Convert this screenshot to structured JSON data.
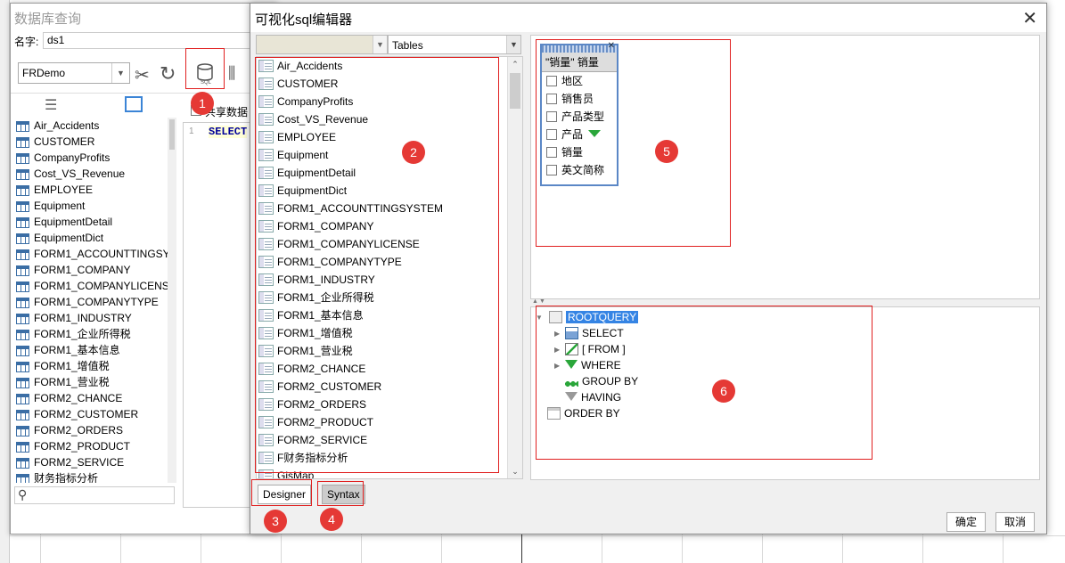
{
  "back_window": {
    "title": "数据库查询",
    "name_label": "名字:",
    "name_value": "ds1",
    "connection": "FRDemo",
    "share_label": "共享数据",
    "line_no": "1",
    "sql_text": "SELECT",
    "tables": [
      "Air_Accidents",
      "CUSTOMER",
      "CompanyProfits",
      "Cost_VS_Revenue",
      "EMPLOYEE",
      "Equipment",
      "EquipmentDetail",
      "EquipmentDict",
      "FORM1_ACCOUNTTINGSY",
      "FORM1_COMPANY",
      "FORM1_COMPANYLICENS",
      "FORM1_COMPANYTYPE",
      "FORM1_INDUSTRY",
      "FORM1_企业所得税",
      "FORM1_基本信息",
      "FORM1_增值税",
      "FORM1_营业税",
      "FORM2_CHANCE",
      "FORM2_CUSTOMER",
      "FORM2_ORDERS",
      "FORM2_PRODUCT",
      "FORM2_SERVICE",
      "财务指标分析"
    ]
  },
  "dialog": {
    "title": "可视化sql编辑器",
    "close_glyph": "✕",
    "type_select": "Tables",
    "tables": [
      "Air_Accidents",
      "CUSTOMER",
      "CompanyProfits",
      "Cost_VS_Revenue",
      "EMPLOYEE",
      "Equipment",
      "EquipmentDetail",
      "EquipmentDict",
      "FORM1_ACCOUNTTINGSYSTEM",
      "FORM1_COMPANY",
      "FORM1_COMPANYLICENSE",
      "FORM1_COMPANYTYPE",
      "FORM1_INDUSTRY",
      "FORM1_企业所得税",
      "FORM1_基本信息",
      "FORM1_增值税",
      "FORM1_营业税",
      "FORM2_CHANCE",
      "FORM2_CUSTOMER",
      "FORM2_ORDERS",
      "FORM2_PRODUCT",
      "FORM2_SERVICE",
      "F财务指标分析",
      "GisMap"
    ],
    "query_table": {
      "header": "\"销量\" 销量",
      "close_glyph": "✕",
      "fields": [
        "地区",
        "销售员",
        "产品类型",
        "产品",
        "销量",
        "英文简称"
      ]
    },
    "tree": {
      "root": "ROOTQUERY",
      "select": "SELECT",
      "from": "[ FROM ]",
      "where": "WHERE",
      "group_by": "GROUP BY",
      "having": "HAVING",
      "order_by": "ORDER BY"
    },
    "tab_designer": "Designer",
    "tab_syntax": "Syntax",
    "ok": "确定",
    "cancel": "取消"
  },
  "badges": [
    "1",
    "2",
    "3",
    "4",
    "5",
    "6"
  ],
  "colors": {
    "annotation_red": "#e53935",
    "selection": "#3584e4"
  }
}
